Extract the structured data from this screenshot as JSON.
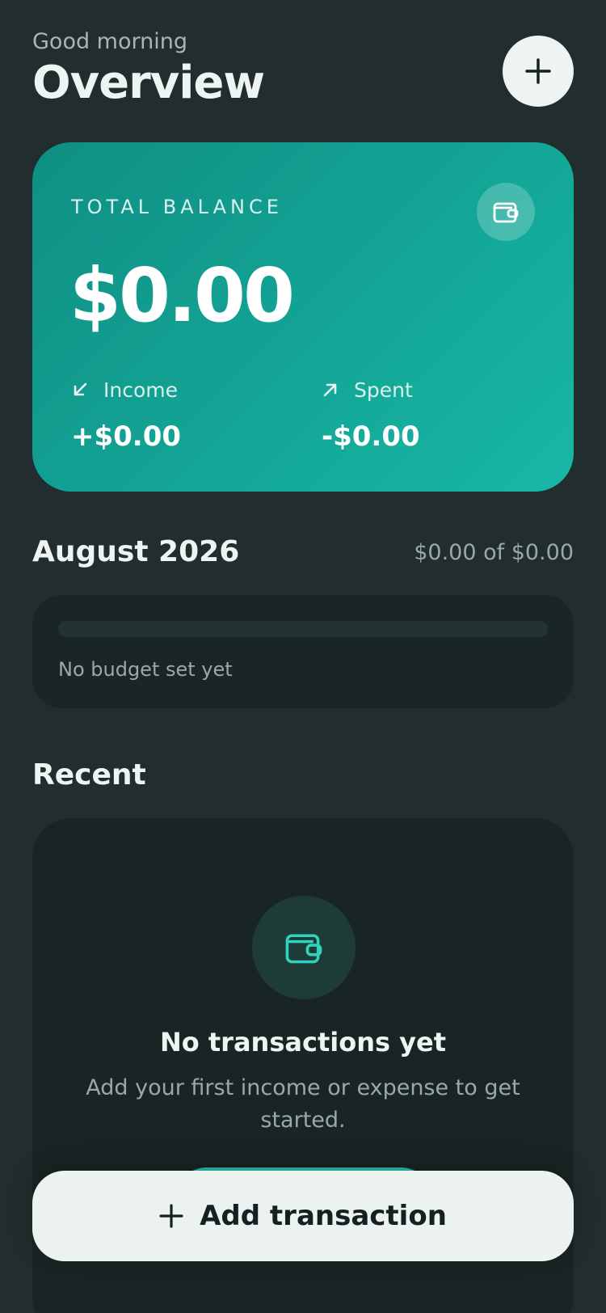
{
  "header": {
    "greeting": "Good morning",
    "title": "Overview",
    "add_icon": "plus-icon"
  },
  "balance": {
    "label": "TOTAL BALANCE",
    "amount": "$0.00",
    "icon": "wallet-icon",
    "income": {
      "label": "Income",
      "value": "+$0.00",
      "icon": "arrow-down-left-icon"
    },
    "spent": {
      "label": "Spent",
      "value": "-$0.00",
      "icon": "arrow-up-right-icon"
    }
  },
  "budget": {
    "month": "August 2026",
    "summary": "$0.00 of $0.00",
    "progress_percent": 0,
    "note": "No budget set yet"
  },
  "recent": {
    "title": "Recent",
    "empty_icon": "wallet-icon",
    "empty_title": "No transactions yet",
    "empty_subtitle": "Add your first income or expense to get started."
  },
  "fab": {
    "label": "Add transaction",
    "icon": "plus-icon"
  },
  "colors": {
    "background": "#212d2e",
    "accent": "#15b6a4",
    "card": "#1a2626",
    "text": "#eef4f2"
  }
}
